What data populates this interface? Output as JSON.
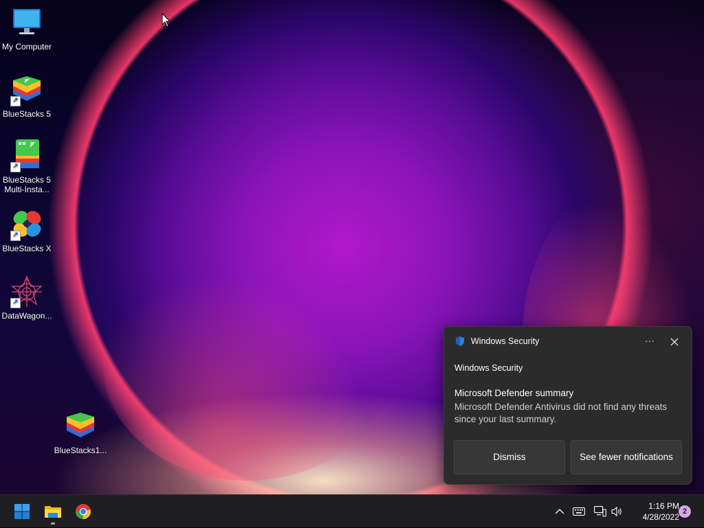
{
  "desktop": {
    "icons": [
      {
        "label": "My Computer",
        "icon": "computer-icon"
      },
      {
        "label": "BlueStacks 5",
        "icon": "bluestacks-icon"
      },
      {
        "label": "BlueStacks 5 Multi-Insta...",
        "icon": "bluestacks-multi-icon"
      },
      {
        "label": "BlueStacks X",
        "icon": "bluestacks-x-icon"
      },
      {
        "label": "DataWagon...",
        "icon": "datawagon-icon"
      },
      {
        "label": "BlueStacks1...",
        "icon": "bluestacks-icon"
      }
    ]
  },
  "notification": {
    "app_name": "Windows Security",
    "subtitle": "Windows Security",
    "title": "Microsoft Defender summary",
    "body": "Microsoft Defender Antivirus did not find any threats since your last summary.",
    "more_glyph": "···",
    "buttons": [
      "Dismiss",
      "See fewer notifications"
    ]
  },
  "taskbar": {
    "pinned": [
      "start-icon",
      "file-explorer-icon",
      "chrome-icon"
    ],
    "tray": [
      "chevron-up-icon",
      "keyboard-icon",
      "network-icon",
      "volume-icon"
    ],
    "time": "1:16 PM",
    "date": "4/28/2022",
    "notification_count": "2"
  },
  "colors": {
    "taskbar_bg": "#1f1f21",
    "toast_bg": "#2b2b2b",
    "badge": "#d9a6e8"
  }
}
